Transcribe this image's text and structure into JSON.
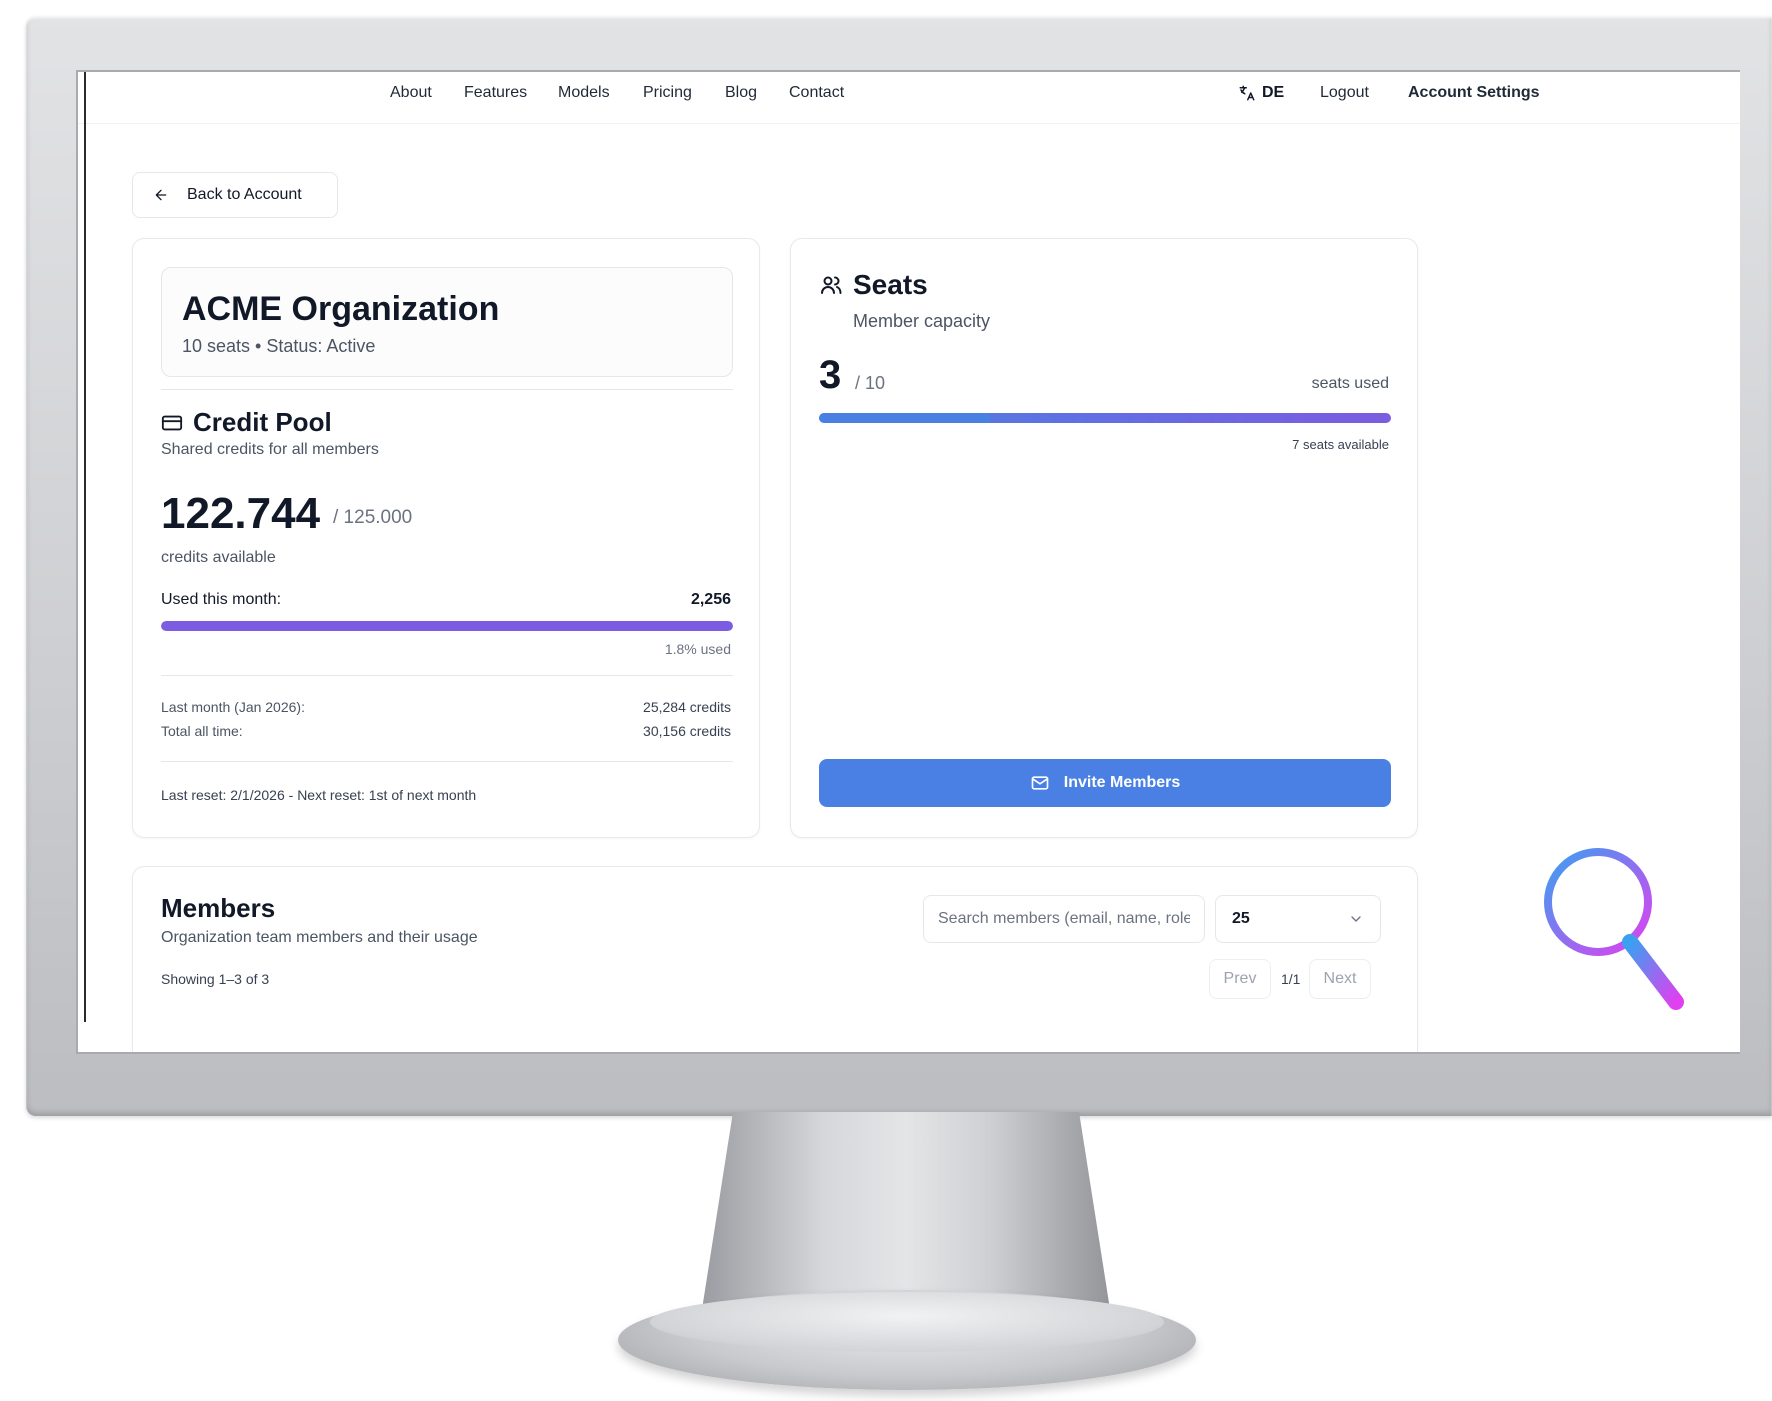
{
  "nav": {
    "items": [
      "About",
      "Features",
      "Models",
      "Pricing",
      "Blog",
      "Contact"
    ],
    "language": "DE",
    "logout": "Logout",
    "account_settings": "Account Settings"
  },
  "back_button": "Back to Account",
  "org": {
    "name": "ACME Organization",
    "subtitle": "10 seats • Status: Active"
  },
  "credit_pool": {
    "title": "Credit Pool",
    "subtitle": "Shared credits for all members",
    "available": "122.744",
    "total": "/ 125.000",
    "available_label": "credits available",
    "used_label": "Used this month:",
    "used_value": "2,256",
    "used_fraction": 0.018,
    "used_percent_label": "1.8% used",
    "last_month_label": "Last month (Jan 2026):",
    "last_month_value": "25,284 credits",
    "total_label": "Total all time:",
    "total_value": "30,156 credits",
    "reset_text": "Last reset: 2/1/2026 - Next reset: 1st of next month",
    "bar_color": "#7c5ce0"
  },
  "seats": {
    "title": "Seats",
    "subtitle": "Member capacity",
    "used": "3",
    "capacity": "/ 10",
    "used_label": "seats used",
    "used_fraction": 0.3,
    "available_label": "7 seats available",
    "invite_label": "Invite Members",
    "bar_color_start": "#4a80e3",
    "bar_color_end": "#7c5ce0"
  },
  "members": {
    "title": "Members",
    "subtitle": "Organization team members and their usage",
    "search_placeholder": "Search members (email, name, role)",
    "page_size": "25",
    "showing": "Showing 1–3 of 3",
    "prev": "Prev",
    "page": "1/1",
    "next": "Next"
  },
  "colors": {
    "accent": "#4a80e3",
    "purple": "#7c5ce0",
    "magnifier_start": "#3aa0f0",
    "magnifier_end": "#e040f0"
  }
}
